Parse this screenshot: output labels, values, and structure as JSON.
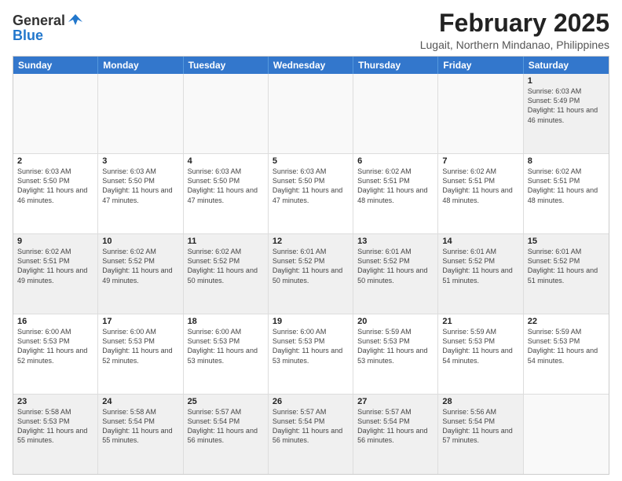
{
  "logo": {
    "general": "General",
    "blue": "Blue"
  },
  "title": "February 2025",
  "location": "Lugait, Northern Mindanao, Philippines",
  "days_of_week": [
    "Sunday",
    "Monday",
    "Tuesday",
    "Wednesday",
    "Thursday",
    "Friday",
    "Saturday"
  ],
  "weeks": [
    [
      {
        "day": "",
        "info": "",
        "empty": true
      },
      {
        "day": "",
        "info": "",
        "empty": true
      },
      {
        "day": "",
        "info": "",
        "empty": true
      },
      {
        "day": "",
        "info": "",
        "empty": true
      },
      {
        "day": "",
        "info": "",
        "empty": true
      },
      {
        "day": "",
        "info": "",
        "empty": true
      },
      {
        "day": "1",
        "info": "Sunrise: 6:03 AM\nSunset: 5:49 PM\nDaylight: 11 hours and 46 minutes."
      }
    ],
    [
      {
        "day": "2",
        "info": "Sunrise: 6:03 AM\nSunset: 5:50 PM\nDaylight: 11 hours and 46 minutes."
      },
      {
        "day": "3",
        "info": "Sunrise: 6:03 AM\nSunset: 5:50 PM\nDaylight: 11 hours and 47 minutes."
      },
      {
        "day": "4",
        "info": "Sunrise: 6:03 AM\nSunset: 5:50 PM\nDaylight: 11 hours and 47 minutes."
      },
      {
        "day": "5",
        "info": "Sunrise: 6:03 AM\nSunset: 5:50 PM\nDaylight: 11 hours and 47 minutes."
      },
      {
        "day": "6",
        "info": "Sunrise: 6:02 AM\nSunset: 5:51 PM\nDaylight: 11 hours and 48 minutes."
      },
      {
        "day": "7",
        "info": "Sunrise: 6:02 AM\nSunset: 5:51 PM\nDaylight: 11 hours and 48 minutes."
      },
      {
        "day": "8",
        "info": "Sunrise: 6:02 AM\nSunset: 5:51 PM\nDaylight: 11 hours and 48 minutes."
      }
    ],
    [
      {
        "day": "9",
        "info": "Sunrise: 6:02 AM\nSunset: 5:51 PM\nDaylight: 11 hours and 49 minutes."
      },
      {
        "day": "10",
        "info": "Sunrise: 6:02 AM\nSunset: 5:52 PM\nDaylight: 11 hours and 49 minutes."
      },
      {
        "day": "11",
        "info": "Sunrise: 6:02 AM\nSunset: 5:52 PM\nDaylight: 11 hours and 50 minutes."
      },
      {
        "day": "12",
        "info": "Sunrise: 6:01 AM\nSunset: 5:52 PM\nDaylight: 11 hours and 50 minutes."
      },
      {
        "day": "13",
        "info": "Sunrise: 6:01 AM\nSunset: 5:52 PM\nDaylight: 11 hours and 50 minutes."
      },
      {
        "day": "14",
        "info": "Sunrise: 6:01 AM\nSunset: 5:52 PM\nDaylight: 11 hours and 51 minutes."
      },
      {
        "day": "15",
        "info": "Sunrise: 6:01 AM\nSunset: 5:52 PM\nDaylight: 11 hours and 51 minutes."
      }
    ],
    [
      {
        "day": "16",
        "info": "Sunrise: 6:00 AM\nSunset: 5:53 PM\nDaylight: 11 hours and 52 minutes."
      },
      {
        "day": "17",
        "info": "Sunrise: 6:00 AM\nSunset: 5:53 PM\nDaylight: 11 hours and 52 minutes."
      },
      {
        "day": "18",
        "info": "Sunrise: 6:00 AM\nSunset: 5:53 PM\nDaylight: 11 hours and 53 minutes."
      },
      {
        "day": "19",
        "info": "Sunrise: 6:00 AM\nSunset: 5:53 PM\nDaylight: 11 hours and 53 minutes."
      },
      {
        "day": "20",
        "info": "Sunrise: 5:59 AM\nSunset: 5:53 PM\nDaylight: 11 hours and 53 minutes."
      },
      {
        "day": "21",
        "info": "Sunrise: 5:59 AM\nSunset: 5:53 PM\nDaylight: 11 hours and 54 minutes."
      },
      {
        "day": "22",
        "info": "Sunrise: 5:59 AM\nSunset: 5:53 PM\nDaylight: 11 hours and 54 minutes."
      }
    ],
    [
      {
        "day": "23",
        "info": "Sunrise: 5:58 AM\nSunset: 5:53 PM\nDaylight: 11 hours and 55 minutes."
      },
      {
        "day": "24",
        "info": "Sunrise: 5:58 AM\nSunset: 5:54 PM\nDaylight: 11 hours and 55 minutes."
      },
      {
        "day": "25",
        "info": "Sunrise: 5:57 AM\nSunset: 5:54 PM\nDaylight: 11 hours and 56 minutes."
      },
      {
        "day": "26",
        "info": "Sunrise: 5:57 AM\nSunset: 5:54 PM\nDaylight: 11 hours and 56 minutes."
      },
      {
        "day": "27",
        "info": "Sunrise: 5:57 AM\nSunset: 5:54 PM\nDaylight: 11 hours and 56 minutes."
      },
      {
        "day": "28",
        "info": "Sunrise: 5:56 AM\nSunset: 5:54 PM\nDaylight: 11 hours and 57 minutes."
      },
      {
        "day": "",
        "info": "",
        "empty": true
      }
    ]
  ]
}
